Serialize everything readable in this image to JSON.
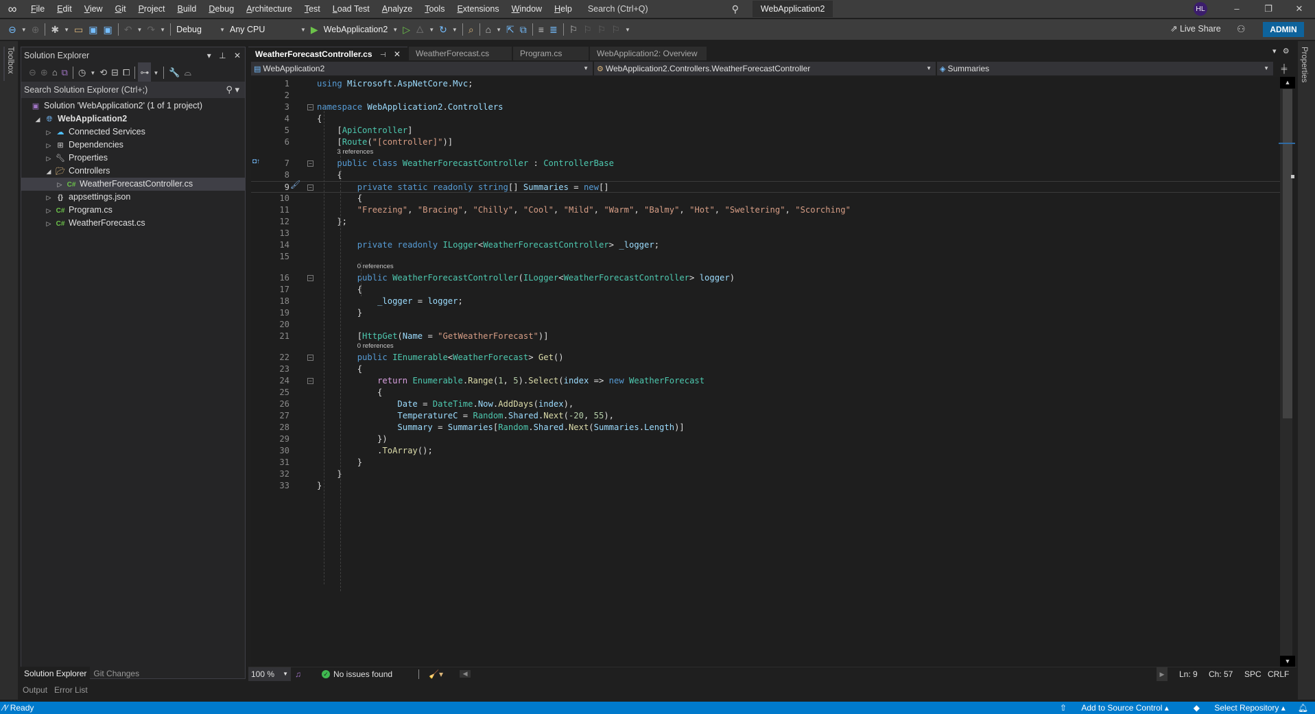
{
  "menubar": {
    "items": [
      "File",
      "Edit",
      "View",
      "Git",
      "Project",
      "Build",
      "Debug",
      "Architecture",
      "Test",
      "Load Test",
      "Analyze",
      "Tools",
      "Extensions",
      "Window",
      "Help"
    ],
    "search_placeholder": "Search (Ctrl+Q)",
    "solution_name": "WebApplication2",
    "avatar_initials": "HL",
    "window_buttons": {
      "minimize": "–",
      "restore": "❐",
      "close": "✕"
    }
  },
  "toolbar": {
    "configuration": "Debug",
    "platform": "Any CPU",
    "startup_project": "WebApplication2",
    "live_share": "Live Share",
    "admin": "ADMIN"
  },
  "side_tabs": {
    "left": "Toolbox",
    "right": "Properties"
  },
  "solution_explorer": {
    "title": "Solution Explorer",
    "search_placeholder": "Search Solution Explorer (Ctrl+;)",
    "tree": [
      {
        "label": "Solution 'WebApplication2' (1 of 1 project)",
        "icon": "solution-icon",
        "level": 0,
        "arrow": ""
      },
      {
        "label": "WebApplication2",
        "icon": "web-project-icon",
        "level": 1,
        "arrow": "expanded",
        "bold": true
      },
      {
        "label": "Connected Services",
        "icon": "connected-services-icon",
        "level": 2,
        "arrow": "collapsed"
      },
      {
        "label": "Dependencies",
        "icon": "dependencies-icon",
        "level": 2,
        "arrow": "collapsed"
      },
      {
        "label": "Properties",
        "icon": "properties-icon",
        "level": 2,
        "arrow": "collapsed"
      },
      {
        "label": "Controllers",
        "icon": "folder-open-icon",
        "level": 2,
        "arrow": "expanded"
      },
      {
        "label": "WeatherForecastController.cs",
        "icon": "csharp-file-icon",
        "level": 3,
        "arrow": "collapsed",
        "selected": true
      },
      {
        "label": "appsettings.json",
        "icon": "json-file-icon",
        "level": 2,
        "arrow": "collapsed"
      },
      {
        "label": "Program.cs",
        "icon": "csharp-file-icon",
        "level": 2,
        "arrow": "collapsed"
      },
      {
        "label": "WeatherForecast.cs",
        "icon": "csharp-file-icon",
        "level": 2,
        "arrow": "collapsed"
      }
    ],
    "bottom_tabs": [
      "Solution Explorer",
      "Git Changes"
    ],
    "lower_tabs": [
      "Output",
      "Error List"
    ]
  },
  "editor": {
    "tabs": [
      {
        "label": "WeatherForecastController.cs",
        "active": true
      },
      {
        "label": "WeatherForecast.cs",
        "active": false
      },
      {
        "label": "Program.cs",
        "active": false
      },
      {
        "label": "WebApplication2: Overview",
        "active": false
      }
    ],
    "nav": {
      "project": "WebApplication2",
      "type": "WebApplication2.Controllers.WeatherForecastController",
      "member": "Summaries"
    },
    "code_lines": [
      {
        "n": 1,
        "text": "using Microsoft.AspNetCore.Mvc;"
      },
      {
        "n": 2,
        "text": ""
      },
      {
        "n": 3,
        "text": "namespace WebApplication2.Controllers"
      },
      {
        "n": 4,
        "text": "{"
      },
      {
        "n": 5,
        "text": "    [ApiController]"
      },
      {
        "n": 6,
        "text": "    [Route(\"[controller]\")]"
      },
      {
        "n": 7,
        "text": "    public class WeatherForecastController : ControllerBase",
        "refs": "3 references"
      },
      {
        "n": 8,
        "text": "    {"
      },
      {
        "n": 9,
        "text": "        private static readonly string[] Summaries = new[]"
      },
      {
        "n": 10,
        "text": "        {"
      },
      {
        "n": 11,
        "text": "        \"Freezing\", \"Bracing\", \"Chilly\", \"Cool\", \"Mild\", \"Warm\", \"Balmy\", \"Hot\", \"Sweltering\", \"Scorching\""
      },
      {
        "n": 12,
        "text": "    };"
      },
      {
        "n": 13,
        "text": ""
      },
      {
        "n": 14,
        "text": "        private readonly ILogger<WeatherForecastController> _logger;"
      },
      {
        "n": 15,
        "text": ""
      },
      {
        "n": 16,
        "text": "        public WeatherForecastController(ILogger<WeatherForecastController> logger)",
        "refs": "0 references"
      },
      {
        "n": 17,
        "text": "        {"
      },
      {
        "n": 18,
        "text": "            _logger = logger;"
      },
      {
        "n": 19,
        "text": "        }"
      },
      {
        "n": 20,
        "text": ""
      },
      {
        "n": 21,
        "text": "        [HttpGet(Name = \"GetWeatherForecast\")]"
      },
      {
        "n": 22,
        "text": "        public IEnumerable<WeatherForecast> Get()",
        "refs": "0 references"
      },
      {
        "n": 23,
        "text": "        {"
      },
      {
        "n": 24,
        "text": "            return Enumerable.Range(1, 5).Select(index => new WeatherForecast"
      },
      {
        "n": 25,
        "text": "            {"
      },
      {
        "n": 26,
        "text": "                Date = DateTime.Now.AddDays(index),"
      },
      {
        "n": 27,
        "text": "                TemperatureC = Random.Shared.Next(-20, 55),"
      },
      {
        "n": 28,
        "text": "                Summary = Summaries[Random.Shared.Next(Summaries.Length)]"
      },
      {
        "n": 29,
        "text": "            })"
      },
      {
        "n": 30,
        "text": "            .ToArray();"
      },
      {
        "n": 31,
        "text": "        }"
      },
      {
        "n": 32,
        "text": "    }"
      },
      {
        "n": 33,
        "text": "}"
      }
    ],
    "current_line": 9,
    "status": {
      "zoom": "100 %",
      "issues": "No issues found",
      "line": "Ln: 9",
      "char": "Ch: 57",
      "whitespace": "SPC",
      "line_ending": "CRLF"
    }
  },
  "statusbar": {
    "state": "Ready",
    "add_to_source_control": "Add to Source Control",
    "select_repository": "Select Repository"
  },
  "colors": {
    "accent": "#007acc",
    "admin": "#0e639c",
    "keyword": "#569cd6",
    "type": "#4ec9b0",
    "string": "#d69d85",
    "control_keyword": "#d8a0df"
  }
}
